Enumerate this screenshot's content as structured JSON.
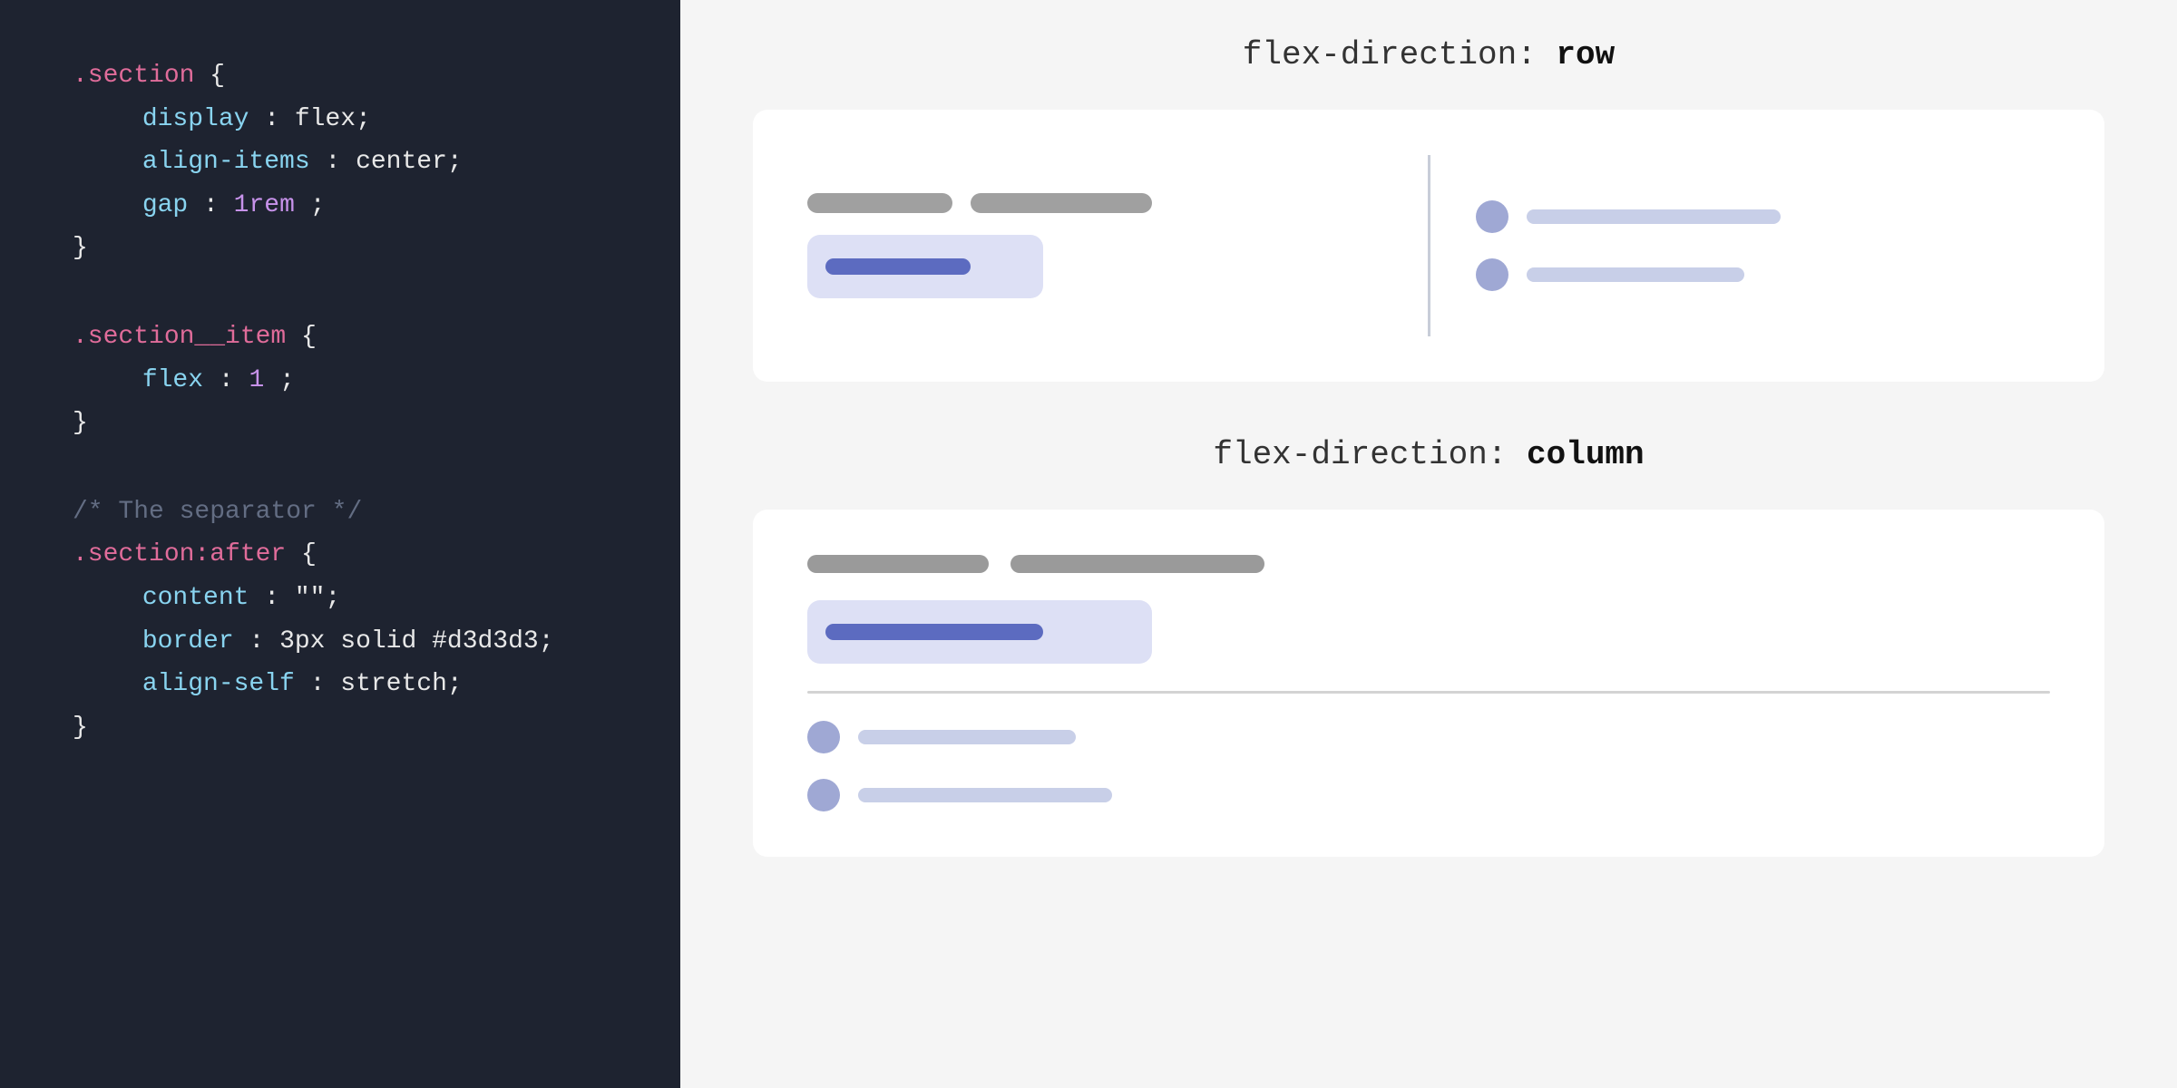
{
  "left": {
    "code_blocks": [
      {
        "id": "section-block",
        "selector": ".section",
        "properties": [
          {
            "prop": "display",
            "value": "flex",
            "value_type": "normal"
          },
          {
            "prop": "align-items",
            "value": "center",
            "value_type": "normal"
          },
          {
            "prop": "gap",
            "value": "1rem",
            "value_type": "special"
          }
        ]
      },
      {
        "id": "section-item-block",
        "selector": ".section__item",
        "properties": [
          {
            "prop": "flex",
            "value": "1",
            "value_type": "special"
          }
        ]
      },
      {
        "id": "section-after-block",
        "comment": "/* The separator */",
        "selector": ".section:after",
        "properties": [
          {
            "prop": "content",
            "value": "\"\"",
            "value_type": "normal"
          },
          {
            "prop": "border",
            "value": "3px solid #d3d3d3",
            "value_type": "normal"
          },
          {
            "prop": "align-self",
            "value": "stretch",
            "value_type": "normal"
          }
        ]
      }
    ]
  },
  "right": {
    "row_title_normal": "flex-direction: ",
    "row_title_bold": "row",
    "col_title_normal": "flex-direction: ",
    "col_title_bold": "column"
  }
}
